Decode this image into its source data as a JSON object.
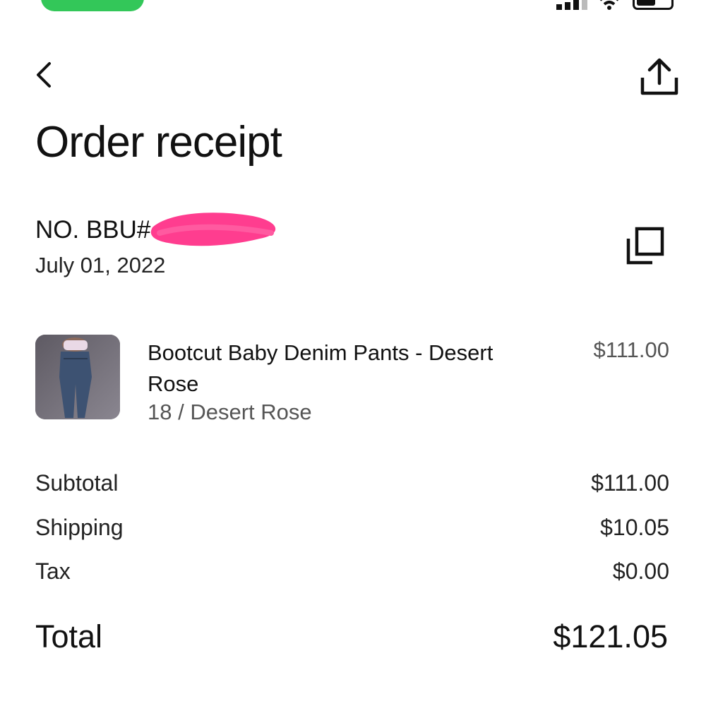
{
  "status_bar": {
    "pill_color": "#33c759",
    "signal_icon": "signal-icon",
    "wifi_icon": "wifi-icon",
    "battery_icon": "battery-icon"
  },
  "header": {
    "back_icon": "chevron-left-icon",
    "share_icon": "share-icon",
    "title": "Order receipt"
  },
  "order": {
    "number": "NO. BBU#",
    "date": "July 01, 2022",
    "copy_icon": "copy-icon",
    "redaction_color": "#ff3d8f"
  },
  "item": {
    "name": "Bootcut Baby Denim Pants - Desert Rose",
    "variant": "18 / Desert Rose",
    "price": "$111.00"
  },
  "summary": {
    "subtotal_label": "Subtotal",
    "subtotal_value": "$111.00",
    "shipping_label": "Shipping",
    "shipping_value": "$10.05",
    "tax_label": "Tax",
    "tax_value": "$0.00",
    "total_label": "Total",
    "total_value": "$121.05"
  }
}
